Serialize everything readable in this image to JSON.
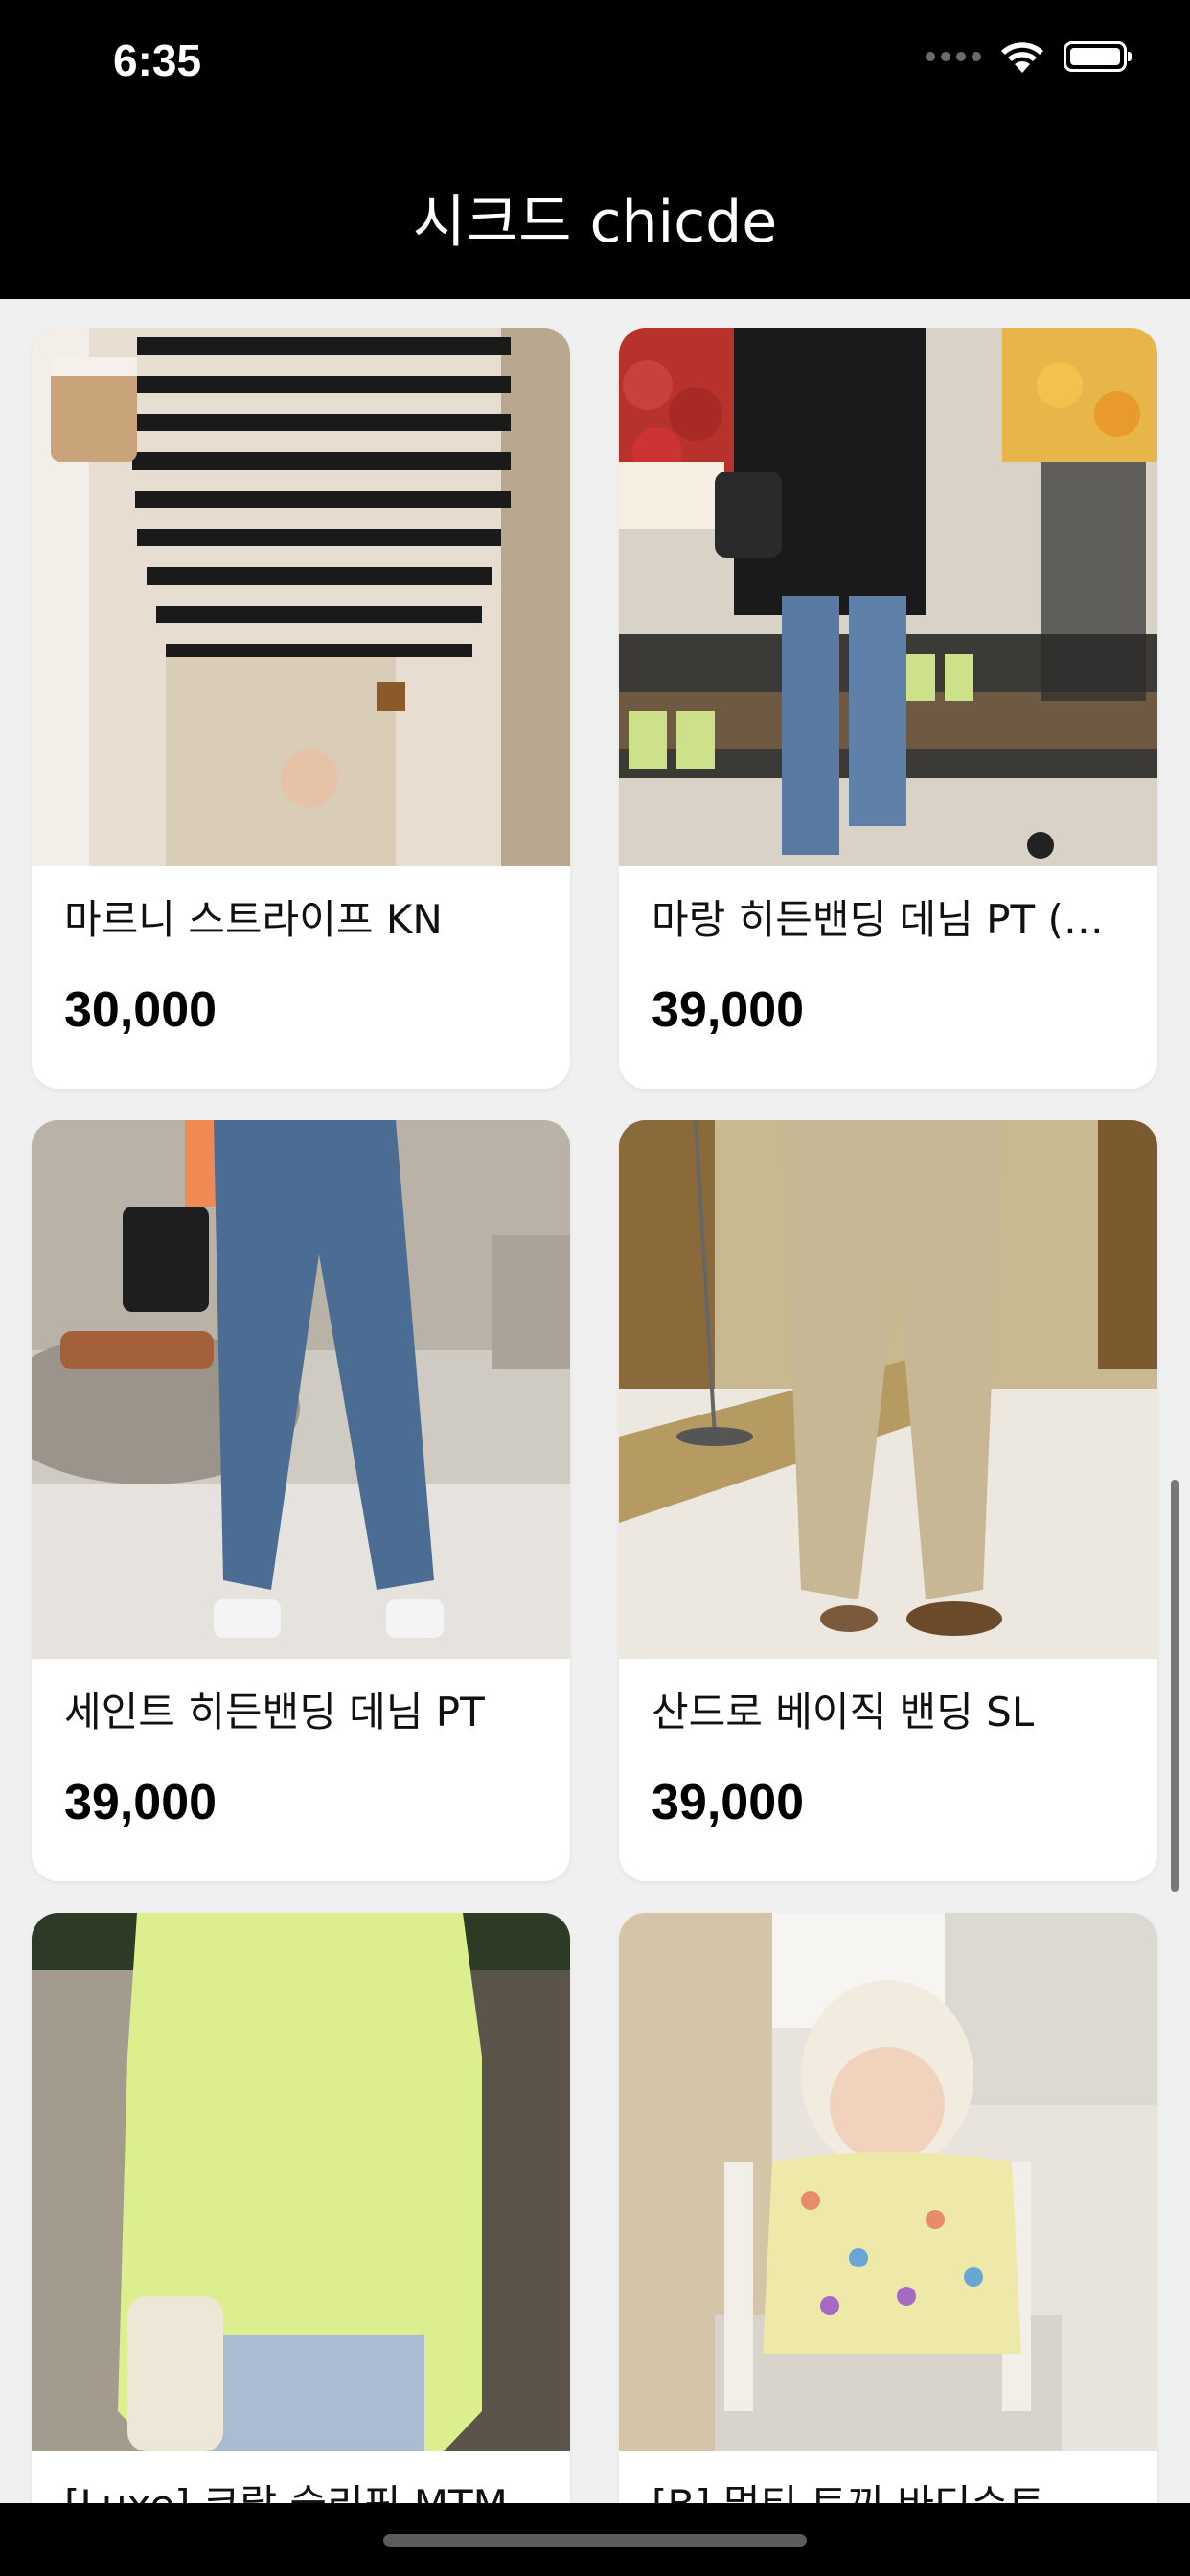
{
  "status_bar": {
    "time": "6:35",
    "icons": [
      "signal-icon",
      "wifi-icon",
      "battery-icon"
    ]
  },
  "nav": {
    "title": "시크드 chicde"
  },
  "products": [
    {
      "name": "마르니 스트라이프 KN",
      "price": "30,000",
      "image": "striped-knit-photo"
    },
    {
      "name": "마랑 히든밴딩 데님 PT (…",
      "price": "39,000",
      "image": "denim-pants-market-photo"
    },
    {
      "name": "세인트 히든밴딩 데님 PT",
      "price": "39,000",
      "image": "blue-denim-photo"
    },
    {
      "name": "산드로 베이직 밴딩 SL",
      "price": "39,000",
      "image": "beige-slacks-photo"
    },
    {
      "name": "[Luxe] 코랄 슬리핏 MTM",
      "price": "",
      "image": "lime-sweatshirt-photo"
    },
    {
      "name": "[B] 멀티 토끼 바디수트",
      "price": "",
      "image": "baby-bodysuit-photo"
    }
  ],
  "colors": {
    "background": "#f0f0f0",
    "bars": "#000000",
    "card": "#ffffff"
  }
}
